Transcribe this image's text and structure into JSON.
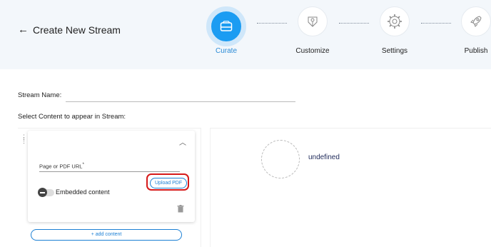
{
  "header": {
    "back_arrow": "←",
    "title": "Create New Stream",
    "steps": [
      {
        "label": "Curate",
        "icon": "tray-icon",
        "active": true
      },
      {
        "label": "Customize",
        "icon": "design-tools-icon",
        "active": false
      },
      {
        "label": "Settings",
        "icon": "gear-icon",
        "active": false
      },
      {
        "label": "Publish",
        "icon": "rocket-icon",
        "active": false
      }
    ]
  },
  "form": {
    "stream_name_label": "Stream Name:",
    "stream_name_value": "",
    "select_content_label": "Select Content to appear in Stream:"
  },
  "content_card": {
    "url_label": "Page or PDF URL",
    "required_mark": "*",
    "upload_button": "Upload PDF",
    "embedded_label": "Embedded content",
    "add_content_button": "+ add content"
  },
  "preview": {
    "text": "undefined"
  },
  "colors": {
    "accent": "#1b9cf2",
    "highlight": "#d61a1a"
  }
}
